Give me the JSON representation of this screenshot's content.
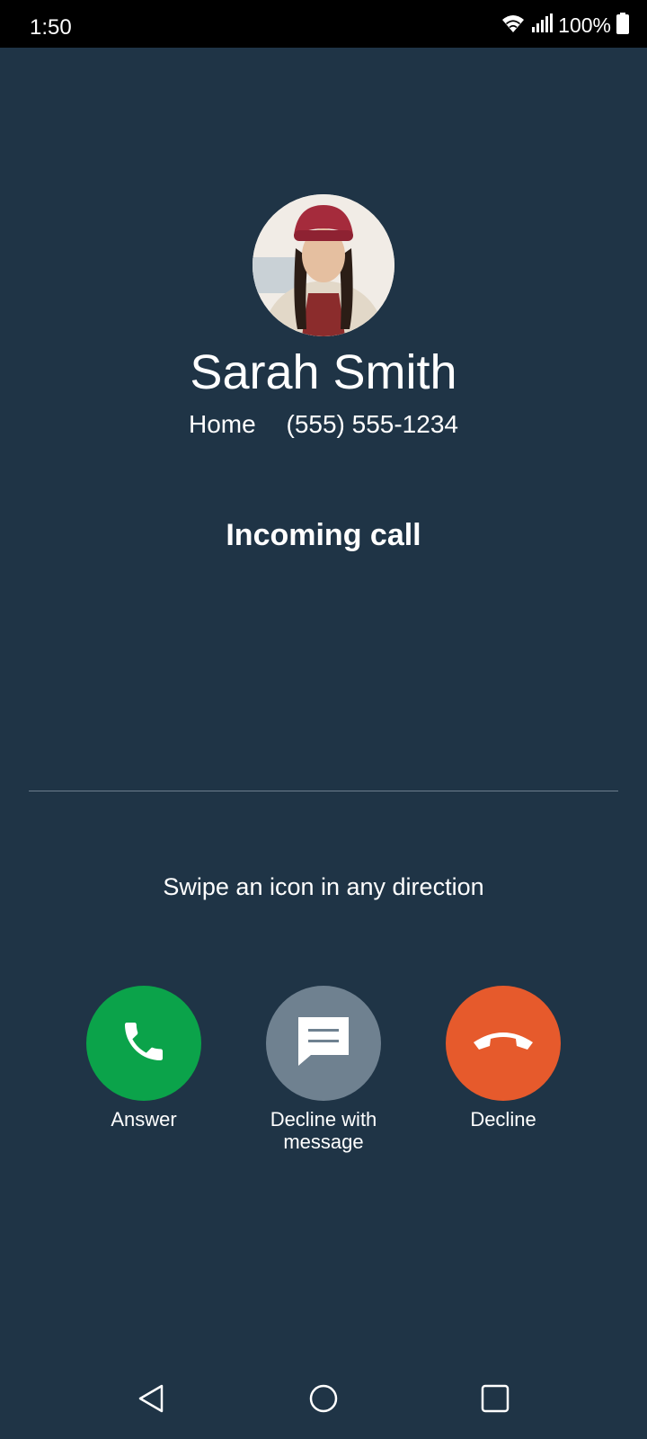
{
  "status_bar": {
    "time": "1:50",
    "battery": "100%",
    "icons": [
      "wifi-icon",
      "signal-icon",
      "battery-icon"
    ]
  },
  "caller": {
    "name": "Sarah Smith",
    "number_label": "Home",
    "number": "(555) 555-1234"
  },
  "call_status": "Incoming call",
  "hint": "Swipe an icon in any direction",
  "actions": {
    "answer": {
      "label": "Answer",
      "icon": "phone-icon",
      "color": "#0ba34a"
    },
    "decline_message": {
      "label": "Decline with message",
      "icon": "message-icon",
      "color": "#6f8190"
    },
    "decline": {
      "label": "Decline",
      "icon": "hang-up-icon",
      "color": "#e65a2c"
    }
  },
  "nav": [
    "back-icon",
    "home-icon",
    "recents-icon"
  ],
  "colors": {
    "background": "#1f3446",
    "status_bar": "#000000"
  }
}
